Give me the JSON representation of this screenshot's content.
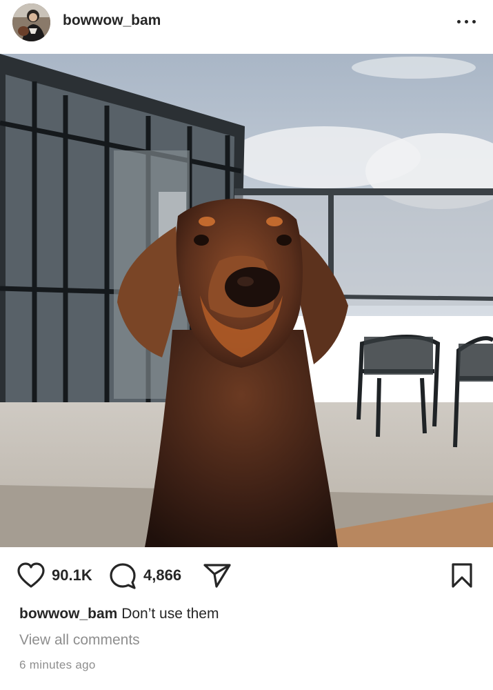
{
  "post": {
    "username": "bowwow_bam",
    "caption_user": "bowwow_bam",
    "caption_text": "Don’t use them",
    "likes": "90.1K",
    "comments": "4,866",
    "view_comments_label": "View all comments",
    "time_ago": "6 minutes ago"
  },
  "icons": {
    "more": "more-options-icon",
    "like": "heart-icon",
    "comment": "comment-bubble-icon",
    "share": "send-icon",
    "save": "bookmark-icon"
  },
  "colors": {
    "text": "#262626",
    "muted": "#8e8e8e",
    "background": "#ffffff"
  }
}
